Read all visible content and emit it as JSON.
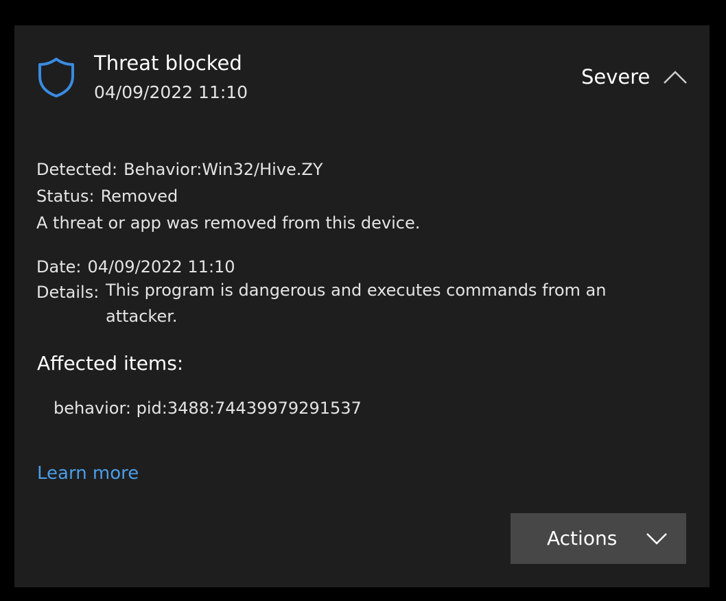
{
  "notification": {
    "title": "Threat blocked",
    "timestamp": "04/09/2022 11:10",
    "severity": "Severe",
    "icon": "shield-icon",
    "accent_color": "#3a8be0"
  },
  "details": {
    "detected_label": "Detected:",
    "detected_value": "Behavior:Win32/Hive.ZY",
    "status_label": "Status:",
    "status_value": "Removed",
    "status_message": "A threat or app was removed from this device.",
    "date_label": "Date:",
    "date_value": "04/09/2022 11:10",
    "details_label": "Details:",
    "details_value": "This program is dangerous and executes commands from an attacker."
  },
  "affected": {
    "heading": "Affected items:",
    "items": [
      "behavior: pid:3488:74439979291537"
    ]
  },
  "links": {
    "learn_more": "Learn more"
  },
  "actions": {
    "label": "Actions"
  }
}
